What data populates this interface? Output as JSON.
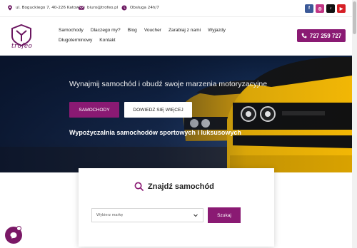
{
  "topbar": {
    "address": "ul. Boguckiego 7, 40-226 Katowice",
    "email": "biuro@trofeo.pl",
    "service": "Obsługa 24h/7",
    "socials": [
      {
        "name": "facebook-icon",
        "glyph": "f",
        "color": "#3b5998"
      },
      {
        "name": "instagram-icon",
        "glyph": "◎",
        "color": "#c13584"
      },
      {
        "name": "tiktok-icon",
        "glyph": "♪",
        "color": "#111111"
      },
      {
        "name": "youtube-icon",
        "glyph": "▶",
        "color": "#d61f26"
      }
    ]
  },
  "header": {
    "logo_text": "trofeo",
    "nav": [
      "Samochody",
      "Dlaczego my?",
      "Blog",
      "Voucher",
      "Zarabiaj z nami",
      "Wyjazdy",
      "Długoterminowy",
      "Kontakt"
    ],
    "phone": "727 259 727"
  },
  "hero": {
    "title": "Wynajmij samochód i obudź swoje marzenia motoryzacyjne",
    "btn_primary": "SAMOCHODY",
    "btn_secondary": "DOWIEDZ SIĘ WIĘCEJ",
    "subtitle": "Wypożyczalnia samochodów sportowych i luksusowych"
  },
  "search": {
    "title": "Znajdź samochód",
    "select_placeholder": "Wybierz markę",
    "button": "Szukaj"
  },
  "colors": {
    "brand": "#8a1a73",
    "car": "#f2b705"
  }
}
